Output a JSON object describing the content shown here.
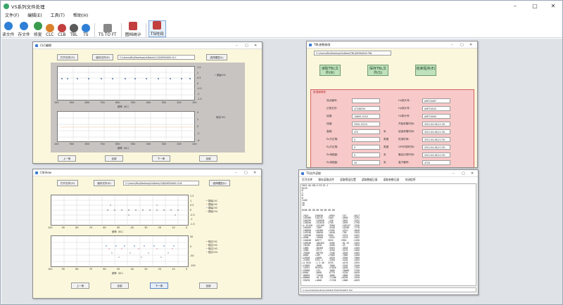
{
  "app": {
    "title": "VS系列文件处理"
  },
  "menu": [
    "文件(F)",
    "编辑(E)",
    "工具(T)",
    "帮助(H)"
  ],
  "toolbar": [
    {
      "label": "读文件",
      "icon": "open-file-icon",
      "color": "#2f7fd6"
    },
    {
      "label": "存文件",
      "icon": "save-file-icon",
      "color": "#2f7fd6"
    },
    {
      "label": "修复",
      "icon": "repair-icon",
      "color": "#3a9b4e"
    },
    {
      "label": "CLC",
      "icon": "clc-icon",
      "color": "#d9822b"
    },
    {
      "label": "CLB",
      "icon": "clb-icon",
      "color": "#c33e3e"
    },
    {
      "label": "TBL",
      "icon": "tbl-icon",
      "color": "#5a5a5a"
    },
    {
      "label": "TS",
      "icon": "ts-icon",
      "color": "#2f7fd6"
    },
    {
      "label": "TS TO FT",
      "icon": "ts-to-ft-icon",
      "color": "#888888"
    },
    {
      "label": "图档统计",
      "icon": "statistics-icon",
      "color": "#c33e3e"
    },
    {
      "label": "TS时间",
      "icon": "ts-time-icon",
      "color": "#c33e3e"
    }
  ],
  "clc_window": {
    "title": "CLC编辑",
    "buttons": [
      "打开文件(O)",
      "保存文件(S)",
      "选择图层(L)"
    ],
    "path": "C:\\Users\\Ws\\Desktop\\VsData\\CLC\\DATA0005.CLC",
    "x_ticks": [
      "100",
      "900",
      "800",
      "700",
      "600",
      "500",
      "400",
      "300",
      "200",
      "100"
    ],
    "x_label": "频率（KC）",
    "y_ticks_top": [
      "1.5",
      "1",
      "0.5",
      "0",
      "-0.5",
      "-1",
      "-1.5"
    ],
    "y_ticks_bottom": [
      "4",
      "2",
      "0",
      "-2",
      "-4"
    ],
    "legend_top": "振幅CH1",
    "legend_bottom": "相位CH1",
    "bottom_buttons": [
      "上一条",
      "全部",
      "下一条",
      "全部"
    ]
  },
  "clb_window": {
    "title": "ClbView",
    "buttons": [
      "打开文件(O)",
      "保存文件(S)",
      "选择图层(L)"
    ],
    "path": "C:\\Users\\Ws\\Desktop\\VsData\\CLB\\DATA0001.CLB",
    "x_ticks": [
      "100",
      "90",
      "80",
      "70",
      "60",
      "50",
      "40",
      "30",
      "20",
      "10",
      "0"
    ],
    "x_label": "频率（KC）",
    "y_ticks_top": [
      "1.5",
      "1",
      "0.5",
      "0",
      "-0.5",
      "-1",
      "-1.5"
    ],
    "y_ticks_bottom": [
      "50",
      "0",
      "-50",
      "-100"
    ],
    "legend_top": [
      "振幅CH1",
      "振幅CH2",
      "振幅CH3",
      "振幅CH4"
    ],
    "legend_bottom": [
      "相位CH1",
      "相位CH2",
      "相位CH3",
      "相位CH4"
    ],
    "bottom_buttons": [
      "上一条",
      "全部",
      "下一条",
      "全部"
    ]
  },
  "tbl_window": {
    "title": "TBL参数修改",
    "path": "C:\\Users\\Ws\\Desktop\\VsData\\TBL\\DATA0004.TBL",
    "action_buttons": [
      "读取TBL文件(R)",
      "保存TBL文件(S)",
      "结束程序(E)"
    ],
    "panel_title": "数据编辑框",
    "left_fields": [
      {
        "label": "测点编号:",
        "value": ""
      },
      {
        "label": "记录文件:",
        "value": "47348250"
      },
      {
        "label": "经度:",
        "value": "10800.123,E"
      },
      {
        "label": "纬度:",
        "value": "3250.123,N"
      },
      {
        "label": "高程:",
        "value": "472",
        "unit": "米"
      },
      {
        "label": "Ex方位角:",
        "value": "0",
        "unit": "角度"
      },
      {
        "label": "Ey方位角:",
        "value": "0",
        "unit": "角度"
      },
      {
        "label": "Ex电极距:",
        "value": "0",
        "unit": "米"
      },
      {
        "label": "Ey电极距:",
        "value": "20",
        "unit": "米"
      }
    ],
    "right_fields": [
      {
        "label": "Hx探头号:",
        "value": "AMTC0067"
      },
      {
        "label": "Hy探头号:",
        "value": "AMTC0025"
      },
      {
        "label": "Hz探头号:",
        "value": "AMTC0000"
      },
      {
        "label": "开始采集时间:",
        "value": "2021-04-08,21:30:"
      },
      {
        "label": "结束采集时间:",
        "value": "2021-04-08,21:30:"
      },
      {
        "label": "校准时间:",
        "value": "2021-04-08,21:30:"
      },
      {
        "label": "GPS时钟时间:",
        "value": "2021-04-08,21:30:"
      },
      {
        "label": "最后记录时间:",
        "value": "2021-04-08,21:30:"
      },
      {
        "label": "盒子编号:",
        "value": "4720"
      }
    ]
  },
  "ts_window": {
    "title": "TS文件读取",
    "menu": [
      "打开文件",
      "保存读取文件",
      "读取预设位置",
      "读取数据记录",
      "读取参数记录",
      "关闭程序"
    ],
    "text_lines": [
      "2021-04-08,3:23:51.1",
      "0118",
      "0",
      "1",
      "0",
      "0",
      "1440",
      "10",
      "16",
      "",
      "0x00 00 00 00 00 00 00 00",
      "",
      "-7624     250658    -6963     -157     -4617",
      "-182566   218232    1505      -4690    -3292",
      "-166299   -226650   -256      -3502    -3292",
      "-158450   -252620   2705      -3499    -2798",
      "+1.91150  -153169   -3960     -103247  -2356",
      "-165463   -7489     -4548     -10290   -7176",
      "-168858   +18480    +2505     -4152    -4848",
      "-149158   -50050    -4648     -796     -1955",
      "-163940   -94050    2905      -4223    -3492",
      "+4908     -15660    -5553     -4133    -3462",
      "-164848   40977     5632      2901     -2496",
      "-169948   -186463   -4506     -81.25   -3495",
      "-76250    -4658     -4560     -43      -7095",
      "-1860     -38260    -9563     -3458    -2405",
      "-3360     -3571     -3550     -9129    -3466",
      "-76500    -60750    -7448     -3540    -3465",
      "-8060     +189      +7000     -7006    -3408",
      "+18350    +2000     -2020     -5300    -7000",
      "-21095    3701.2    -3300     -5440    -3465",
      "+4.3525   -2.3.46   5255      -4470    -3495",
      "+15095    -1000     -7000     -2918    -3450",
      "-10787    301952    -47020    -4830    -1765",
      "+20998    -413      -1800     -70060   -3790",
      "+0905     -4068     -6770     -5220    -4050",
      "-08099    -71050    -1800     -2800    -1990",
      "+08600    -10.55    -71208    +8290    -3450",
      "-93070    +1000     -71705    -1800    -4059"
    ],
    "status_path": "C:\\Users\\Ws\\Desktop\\VsData\\TS\\DATA0001.TS2"
  }
}
